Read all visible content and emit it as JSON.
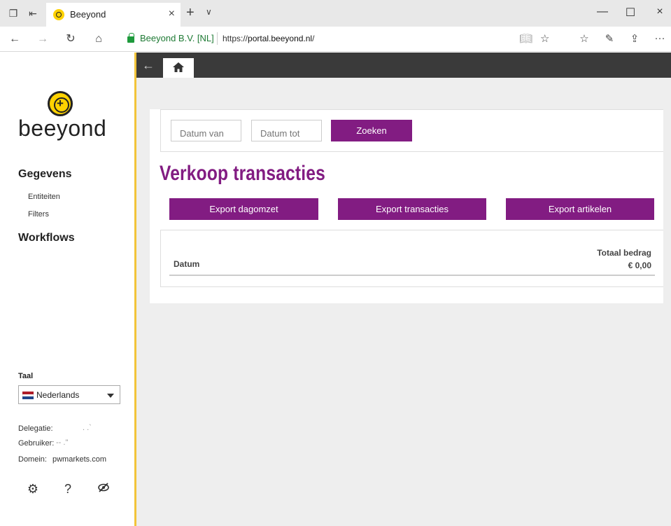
{
  "browser": {
    "tab_title": "Beeyond",
    "tab_close": "×",
    "new_tab": "+",
    "tab_menu": "∨",
    "win_minimize": "—",
    "win_maximize": "☐",
    "win_close": "×",
    "cert_label": "Beeyond B.V. [NL]",
    "url_prefix": "https://",
    "url_host": "portal.beeyond.nl",
    "url_suffix": "/",
    "more": "···"
  },
  "sidebar": {
    "logo_text": "beeyond",
    "logo_plus": "+",
    "sections": [
      {
        "label": "Gegevens",
        "items": [
          "Entiteiten",
          "Filters"
        ]
      },
      {
        "label": "Workflows",
        "items": []
      }
    ],
    "language_label": "Taal",
    "language_value": "Nederlands",
    "flag_colors": [
      "#ae1c28",
      "#ffffff",
      "#21468b"
    ],
    "info": [
      {
        "label": "Delegatie:",
        "value": ". .`"
      },
      {
        "label": "Gebruiker:",
        "value": "-- .\""
      },
      {
        "label": "Domein:",
        "value": "pwmarkets.com"
      }
    ],
    "footer_icons": [
      "gear-icon",
      "help-icon",
      "eye-slash-icon"
    ]
  },
  "main": {
    "filter": {
      "date_from_placeholder": "Datum van",
      "date_to_placeholder": "Datum tot",
      "search_label": "Zoeken"
    },
    "title": "Verkoop transacties",
    "buttons": [
      "Export dagomzet",
      "Export transacties",
      "Export artikelen"
    ],
    "table": {
      "col_date": "Datum",
      "col_total": "Totaal bedrag",
      "total_amount": "€ 0,00"
    }
  },
  "colors": {
    "accent": "#821c82",
    "sidebar_border": "#f2c43a",
    "appbar": "#3a3a3a"
  }
}
